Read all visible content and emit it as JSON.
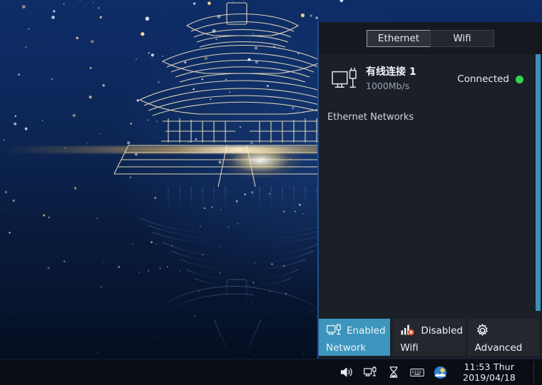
{
  "desktop": {
    "wallpaper_name": "temple-of-heaven-line-art",
    "bg_top_color": "#0e2d66",
    "bg_bottom_color": "#040b1a",
    "accent_gold": "#ffc864"
  },
  "taskbar": {
    "tray_icons": [
      {
        "name": "volume-icon",
        "glyph": "volume"
      },
      {
        "name": "network-tray-icon",
        "glyph": "ethernet"
      },
      {
        "name": "hourglass-icon",
        "glyph": "hourglass"
      },
      {
        "name": "keyboard-icon",
        "glyph": "keyboard"
      },
      {
        "name": "weather-icon",
        "glyph": "weather"
      }
    ],
    "clock": {
      "time_line": "11:53 Thur",
      "date_line": "2019/04/18"
    }
  },
  "network_panel": {
    "accent_color": "#3d95bd",
    "tabs": [
      {
        "label": "Ethernet",
        "active": true
      },
      {
        "label": "Wifi",
        "active": false
      }
    ],
    "connection": {
      "icon_name": "ethernet-device-icon",
      "name": "有线连接 1",
      "speed": "1000Mb/s",
      "status": "Connected",
      "status_color": "#35d44a"
    },
    "section_title": "Ethernet Networks",
    "footer_buttons": [
      {
        "icon_name": "ethernet-device-icon",
        "state": "Enabled",
        "label": "Network",
        "primary": true
      },
      {
        "icon_name": "wifi-disabled-icon",
        "state": "Disabled",
        "label": "Wifi",
        "primary": false
      },
      {
        "icon_name": "gear-icon",
        "state": "",
        "label": "Advanced",
        "primary": false
      }
    ]
  }
}
